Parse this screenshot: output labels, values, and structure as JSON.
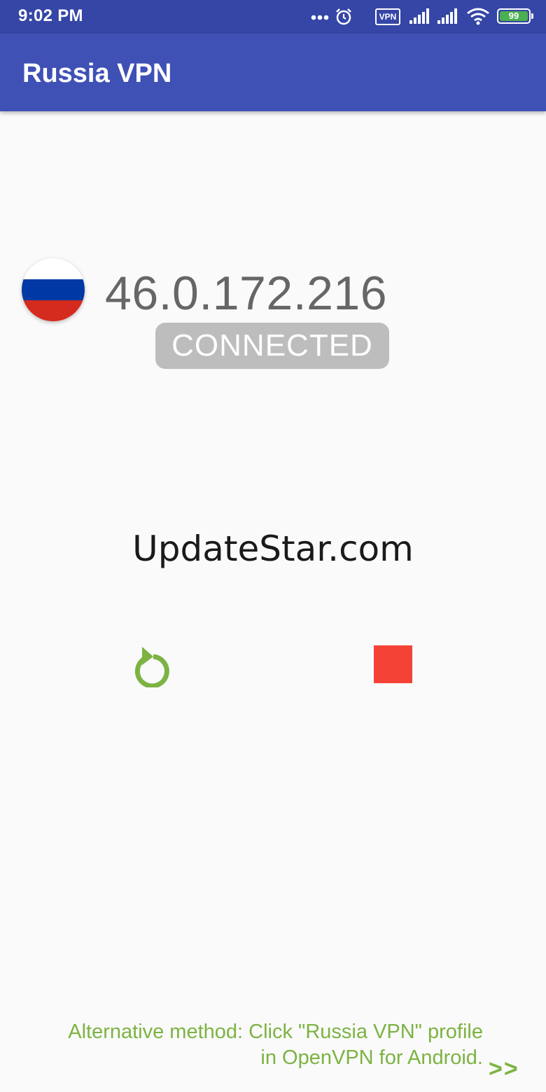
{
  "status_bar": {
    "time": "9:02 PM",
    "vpn_label": "VPN",
    "battery": "99",
    "icons": [
      "more-dots-icon",
      "alarm-icon",
      "vpn-icon",
      "signal-icon",
      "signal-icon",
      "wifi-icon",
      "battery-icon"
    ]
  },
  "app_bar": {
    "title": "Russia VPN"
  },
  "server": {
    "flag": "russia-flag",
    "flag_colors": [
      "#ffffff",
      "#0039a6",
      "#d52b1e"
    ],
    "ip": "46.0.172.216",
    "status": "CONNECTED"
  },
  "watermark": "UpdateStar.com",
  "controls": {
    "reconnect_icon": "reconnect-icon",
    "stop_icon": "stop-icon",
    "reconnect_color": "#7cb342",
    "stop_color": "#f44336"
  },
  "footer": {
    "line1": "Alternative method: Click \"Russia VPN\" profile",
    "line2": "in OpenVPN for Android.",
    "arrow": ">>",
    "color": "#7cb342"
  },
  "colors": {
    "status_bar": "#3546a6",
    "app_bar": "#3f51b5",
    "background": "#fafafa"
  }
}
